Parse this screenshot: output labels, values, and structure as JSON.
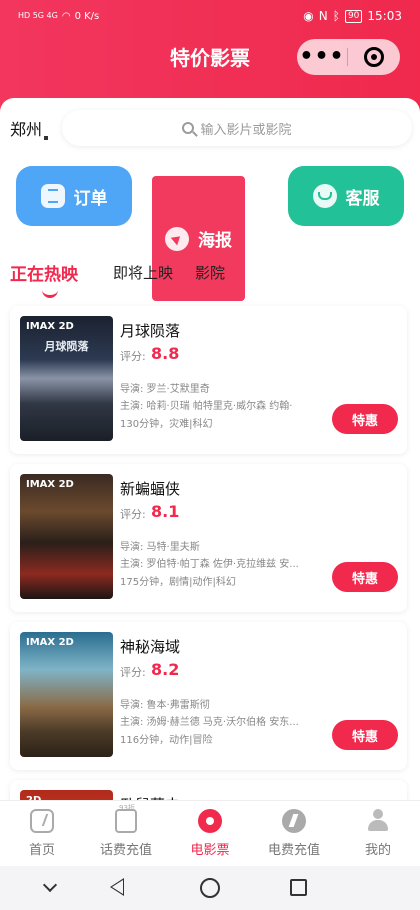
{
  "status_bar": {
    "left_text": "HD 5G 4G",
    "speed": "0 K/s",
    "battery": "90",
    "time": "15:03"
  },
  "header": {
    "title": "特价影票",
    "bg_color": "#f0294d"
  },
  "search": {
    "city": "郑州",
    "placeholder": "输入影片或影院"
  },
  "quick_actions": [
    {
      "label": "订单",
      "icon": "order-icon",
      "color": "#4fa6f6"
    },
    {
      "label": "海报",
      "icon": "paper-plane-icon",
      "color": "#f13a5d"
    },
    {
      "label": "客服",
      "icon": "headset-icon",
      "color": "#22c197"
    }
  ],
  "tabs": [
    {
      "label": "正在热映",
      "active": true
    },
    {
      "label": "即将上映",
      "active": false
    },
    {
      "label": "影院",
      "active": false
    }
  ],
  "movies": [
    {
      "name": "月球陨落",
      "score_label": "评分:",
      "score": "8.8",
      "director": "导演: 罗兰·艾默里奇",
      "cast": "主演: 哈莉·贝瑞 帕特里克·威尔森 约翰·",
      "info": "130分钟，灾难|科幻",
      "button": "特惠",
      "poster_tag": "IMAX 2D",
      "poster_title": "月球陨落"
    },
    {
      "name": "新蝙蝠侠",
      "score_label": "评分:",
      "score": "8.1",
      "director": "导演: 马特·里夫斯",
      "cast": "主演: 罗伯特·帕丁森 佐伊·克拉维兹 安...",
      "info": "175分钟，剧情|动作|科幻",
      "button": "特惠",
      "poster_tag": "IMAX 2D",
      "poster_title": ""
    },
    {
      "name": "神秘海域",
      "score_label": "评分:",
      "score": "8.2",
      "director": "导演: 鲁本·弗雷斯彻",
      "cast": "主演: 汤姆·赫兰德 马克·沃尔伯格 安东...",
      "info": "116分钟，动作|冒险",
      "button": "特惠",
      "poster_tag": "IMAX 2D",
      "poster_title": ""
    },
    {
      "name": "卧鼠藏虫",
      "poster_tag": "2D"
    }
  ],
  "tabbar": [
    {
      "label": "首页",
      "icon": "home-bolt-icon",
      "active": false
    },
    {
      "label": "话费充值",
      "icon": "phone-icon",
      "active": false
    },
    {
      "label": "电影票",
      "icon": "film-reel-icon",
      "active": true
    },
    {
      "label": "电费充值",
      "icon": "electricity-icon",
      "active": false
    },
    {
      "label": "我的",
      "icon": "user-icon",
      "active": false
    }
  ]
}
